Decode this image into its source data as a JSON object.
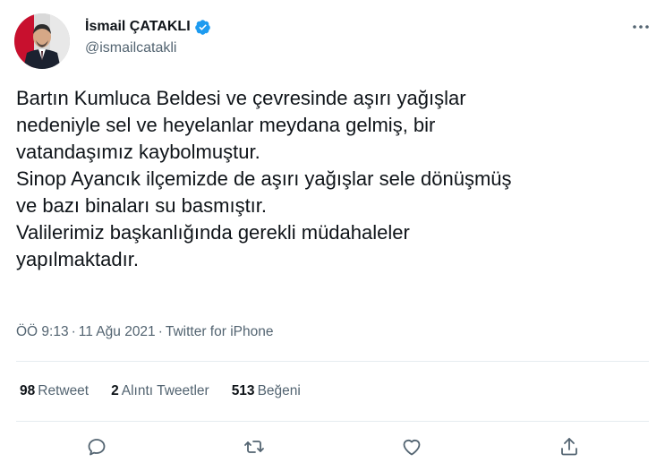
{
  "author": {
    "display_name": "İsmail ÇATAKLI",
    "handle": "@ismailcatakli",
    "verified": true,
    "verified_icon": "verified-badge-icon"
  },
  "tweet": {
    "lines": [
      "Bartın Kumluca Beldesi ve çevresinde aşırı yağışlar",
      "nedeniyle sel ve heyelanlar meydana gelmiş, bir",
      "vatandaşımız kaybolmuştur.",
      "Sinop Ayancık ilçemizde de aşırı yağışlar sele dönüşmüş",
      "ve bazı binaları su basmıştır.",
      "Valilerimiz başkanlığında gerekli müdahaleler",
      "yapılmaktadır."
    ]
  },
  "meta": {
    "time": "ÖÖ 9:13",
    "separator": "·",
    "date": "11 Ağu 2021",
    "source": "Twitter for iPhone"
  },
  "stats": {
    "retweets": {
      "count": "98",
      "label": "Retweet"
    },
    "quotes": {
      "count": "2",
      "label": "Alıntı Tweetler"
    },
    "likes": {
      "count": "513",
      "label": "Beğeni"
    }
  },
  "actions": [
    "reply-icon",
    "retweet-icon",
    "like-icon",
    "share-icon"
  ],
  "colors": {
    "text": "#0f1419",
    "secondary": "#536471",
    "verified": "#1d9bf0",
    "divider": "#e6ecf0"
  }
}
